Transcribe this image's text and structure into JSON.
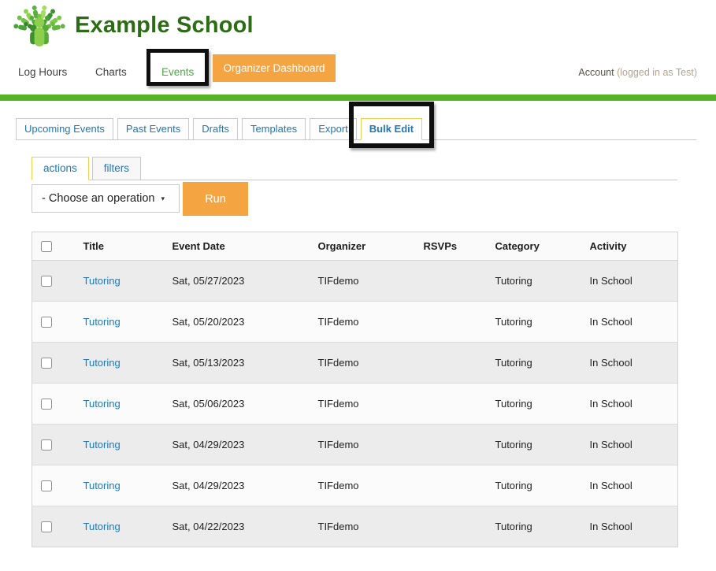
{
  "brand": {
    "school_name": "Example School",
    "logo_icon": "people-tree-icon"
  },
  "nav": {
    "items": [
      {
        "label": "Log Hours"
      },
      {
        "label": "Charts"
      },
      {
        "label": "Events",
        "active": true
      }
    ],
    "dashboard_button_label": "Organizer Dashboard",
    "account_label": "Account",
    "account_status": "(logged in as Test)"
  },
  "event_tabs": [
    {
      "label": "Upcoming Events"
    },
    {
      "label": "Past Events"
    },
    {
      "label": "Drafts"
    },
    {
      "label": "Templates"
    },
    {
      "label": "Export"
    },
    {
      "label": "Bulk Edit",
      "active": true
    }
  ],
  "bulk_edit": {
    "subtabs": [
      {
        "label": "actions",
        "active": true
      },
      {
        "label": "filters"
      }
    ],
    "operation_select_value": "- Choose an operation",
    "caret_icon": "caret-down-icon",
    "run_button_label": "Run"
  },
  "table": {
    "columns": [
      "Title",
      "Event Date",
      "Organizer",
      "RSVPs",
      "Category",
      "Activity"
    ],
    "rows": [
      {
        "title": "Tutoring",
        "event_date": "Sat, 05/27/2023",
        "organizer": "TIFdemo",
        "rsvps": "",
        "category": "Tutoring",
        "activity": "In School"
      },
      {
        "title": "Tutoring",
        "event_date": "Sat, 05/20/2023",
        "organizer": "TIFdemo",
        "rsvps": "",
        "category": "Tutoring",
        "activity": "In School"
      },
      {
        "title": "Tutoring",
        "event_date": "Sat, 05/13/2023",
        "organizer": "TIFdemo",
        "rsvps": "",
        "category": "Tutoring",
        "activity": "In School"
      },
      {
        "title": "Tutoring",
        "event_date": "Sat, 05/06/2023",
        "organizer": "TIFdemo",
        "rsvps": "",
        "category": "Tutoring",
        "activity": "In School"
      },
      {
        "title": "Tutoring",
        "event_date": "Sat, 04/29/2023",
        "organizer": "TIFdemo",
        "rsvps": "",
        "category": "Tutoring",
        "activity": "In School"
      },
      {
        "title": "Tutoring",
        "event_date": "Sat, 04/29/2023",
        "organizer": "TIFdemo",
        "rsvps": "",
        "category": "Tutoring",
        "activity": "In School"
      },
      {
        "title": "Tutoring",
        "event_date": "Sat, 04/22/2023",
        "organizer": "TIFdemo",
        "rsvps": "",
        "category": "Tutoring",
        "activity": "In School"
      }
    ]
  },
  "annotations": [
    {
      "name": "events-nav-highlight"
    },
    {
      "name": "bulk-edit-tab-highlight"
    }
  ],
  "colors": {
    "accent_green_bar": "#55b425",
    "brand_green": "#2c6c14",
    "nav_active_green": "#4cab45",
    "accent_orange": "#f5a442",
    "tab_link_blue": "#2178b5",
    "active_tab_border_yellow": "#f0cf4e"
  }
}
